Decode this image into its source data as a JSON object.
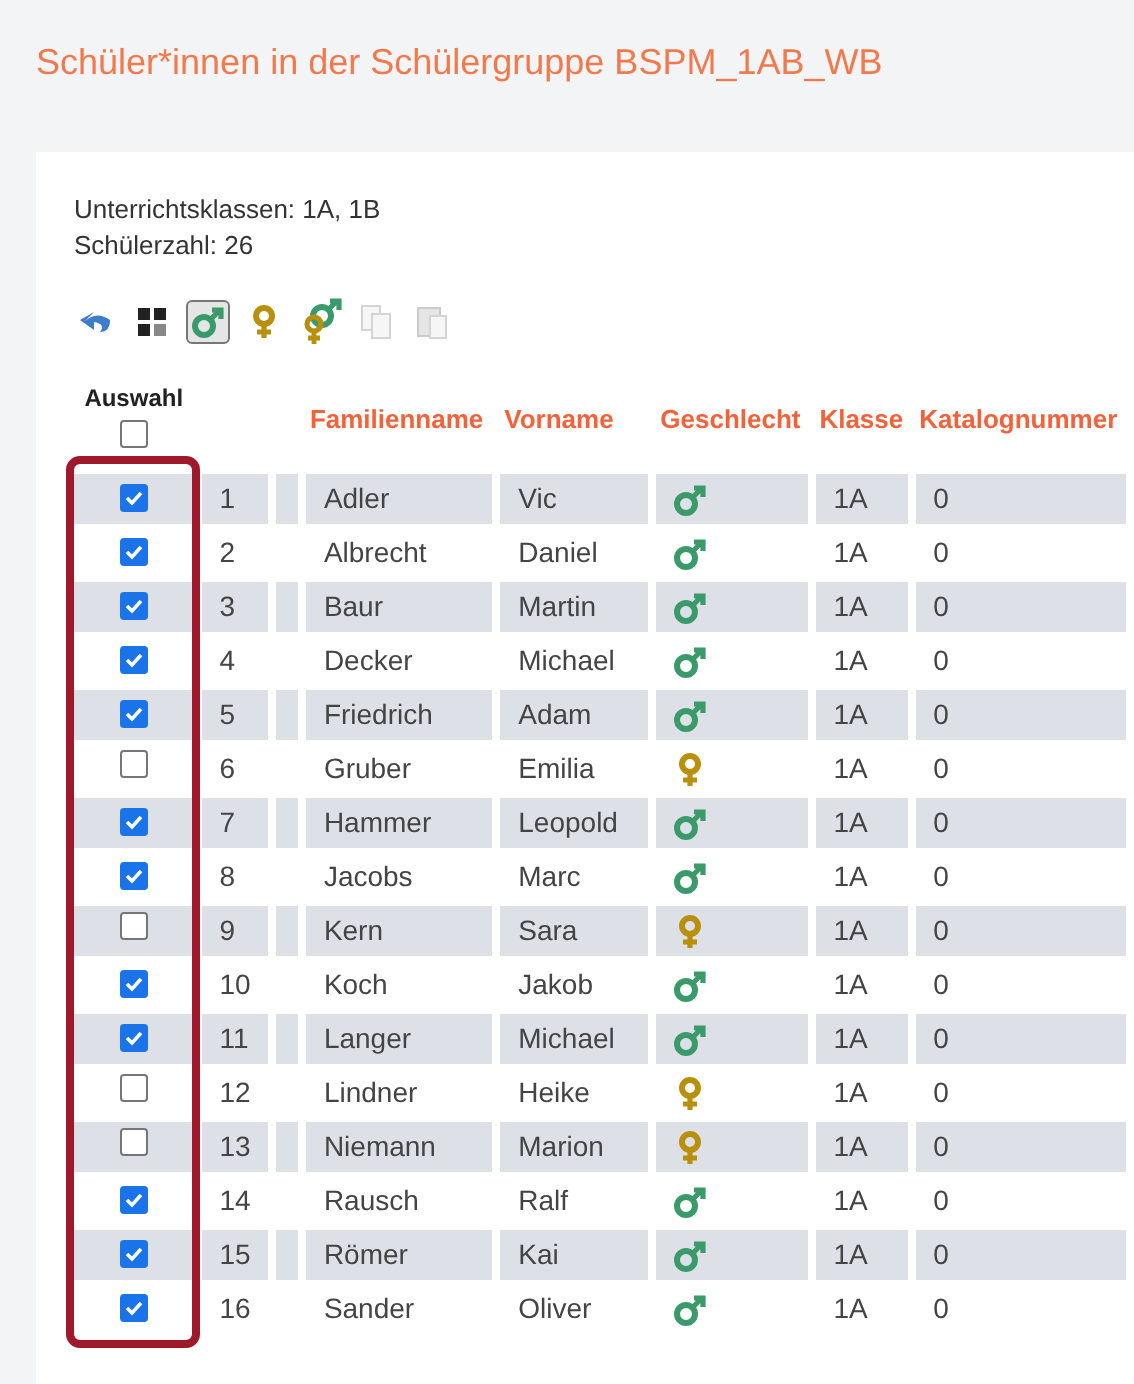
{
  "title": "Schüler*innen in der Schülergruppe BSPM_1AB_WB",
  "info": [
    "Unterrichtsklassen: 1A, 1B",
    "Schülerzahl: 26"
  ],
  "toolbar": [
    {
      "kind": "undo",
      "selected": false,
      "disabled": false
    },
    {
      "kind": "grid",
      "selected": false,
      "disabled": false
    },
    {
      "kind": "male",
      "selected": true,
      "disabled": false
    },
    {
      "kind": "female",
      "selected": false,
      "disabled": false
    },
    {
      "kind": "both",
      "selected": false,
      "disabled": false
    },
    {
      "kind": "copy",
      "selected": false,
      "disabled": true
    },
    {
      "kind": "paste",
      "selected": false,
      "disabled": true
    }
  ],
  "table": {
    "select_header": "Auswahl",
    "select_all_checked": false,
    "columns": [
      "Familienname",
      "Vorname",
      "Geschlecht",
      "Klasse",
      "Katalognummer"
    ],
    "rows": [
      {
        "checked": true,
        "number": "1",
        "last": "Adler",
        "first": "Vic",
        "kind": "male",
        "class": "1A",
        "catalog": "0"
      },
      {
        "checked": true,
        "number": "2",
        "last": "Albrecht",
        "first": "Daniel",
        "kind": "male",
        "class": "1A",
        "catalog": "0"
      },
      {
        "checked": true,
        "number": "3",
        "last": "Baur",
        "first": "Martin",
        "kind": "male",
        "class": "1A",
        "catalog": "0"
      },
      {
        "checked": true,
        "number": "4",
        "last": "Decker",
        "first": "Michael",
        "kind": "male",
        "class": "1A",
        "catalog": "0"
      },
      {
        "checked": true,
        "number": "5",
        "last": "Friedrich",
        "first": "Adam",
        "kind": "male",
        "class": "1A",
        "catalog": "0"
      },
      {
        "checked": false,
        "number": "6",
        "last": "Gruber",
        "first": "Emilia",
        "kind": "female",
        "class": "1A",
        "catalog": "0"
      },
      {
        "checked": true,
        "number": "7",
        "last": "Hammer",
        "first": "Leopold",
        "kind": "male",
        "class": "1A",
        "catalog": "0"
      },
      {
        "checked": true,
        "number": "8",
        "last": "Jacobs",
        "first": "Marc",
        "kind": "male",
        "class": "1A",
        "catalog": "0"
      },
      {
        "checked": false,
        "number": "9",
        "last": "Kern",
        "first": "Sara",
        "kind": "female",
        "class": "1A",
        "catalog": "0"
      },
      {
        "checked": true,
        "number": "10",
        "last": "Koch",
        "first": "Jakob",
        "kind": "male",
        "class": "1A",
        "catalog": "0"
      },
      {
        "checked": true,
        "number": "11",
        "last": "Langer",
        "first": "Michael",
        "kind": "male",
        "class": "1A",
        "catalog": "0"
      },
      {
        "checked": false,
        "number": "12",
        "last": "Lindner",
        "first": "Heike",
        "kind": "female",
        "class": "1A",
        "catalog": "0"
      },
      {
        "checked": false,
        "number": "13",
        "last": "Niemann",
        "first": "Marion",
        "kind": "female",
        "class": "1A",
        "catalog": "0"
      },
      {
        "checked": true,
        "number": "14",
        "last": "Rausch",
        "first": "Ralf",
        "kind": "male",
        "class": "1A",
        "catalog": "0"
      },
      {
        "checked": true,
        "number": "15",
        "last": "Römer",
        "first": "Kai",
        "kind": "male",
        "class": "1A",
        "catalog": "0"
      },
      {
        "checked": true,
        "number": "16",
        "last": "Sander",
        "first": "Oliver",
        "kind": "male",
        "class": "1A",
        "catalog": "0"
      }
    ]
  }
}
